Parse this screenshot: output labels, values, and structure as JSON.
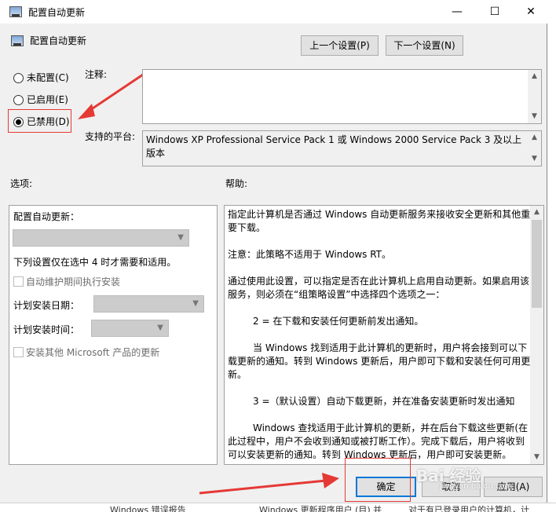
{
  "window": {
    "title": "配置自动更新",
    "minimize_glyph": "—",
    "maximize_glyph": "☐",
    "close_glyph": "✕"
  },
  "header": {
    "policy_name": "配置自动更新",
    "prev_setting": "上一个设置(P)",
    "next_setting": "下一个设置(N)"
  },
  "state": {
    "options": [
      {
        "label": "未配置(C)",
        "checked": false
      },
      {
        "label": "已启用(E)",
        "checked": false
      },
      {
        "label": "已禁用(D)",
        "checked": true
      }
    ]
  },
  "comment": {
    "label": "注释:",
    "value": ""
  },
  "platform": {
    "label": "支持的平台:",
    "value": "Windows XP Professional Service Pack 1 或 Windows 2000 Service Pack 3 及以上版本"
  },
  "options_section": {
    "label": "选项:",
    "configure_label": "配置自动更新：",
    "note": "下列设置仅在选中 4 时才需要和适用。",
    "maintenance_checkbox": "自动维护期间执行安装",
    "install_day_label": "计划安装日期：",
    "install_time_label": "计划安装时间：",
    "other_products_checkbox": "安装其他 Microsoft 产品的更新"
  },
  "help_section": {
    "label": "帮助:",
    "paragraphs": [
      "指定此计算机是否通过 Windows 自动更新服务来接收安全更新和其他重要下载。",
      "注意：此策略不适用于 Windows RT。",
      "通过使用此设置，可以指定是否在此计算机上启用自动更新。如果启用该服务，则必须在“组策略设置”中选择四个选项之一：",
      "2 = 在下载和安装任何更新前发出通知。",
      "当 Windows 找到适用于此计算机的更新时，用户将会接到可以下载更新的通知。转到 Windows 更新后，用户即可下载和安装任何可用更新。",
      "3 =（默认设置）自动下载更新，并在准备安装更新时发出通知",
      "Windows 查找适用于此计算机的更新，并在后台下载这些更新(在此过程中，用户不会收到通知或被打断工作）。完成下载后，用户将收到可以安装更新的通知。转到 Windows 更新后，用户即可安装更新。"
    ]
  },
  "footer": {
    "ok": "确定",
    "cancel": "取消",
    "apply": "应用(A)"
  },
  "background": {
    "bottom_left": "Windows 错误报告",
    "bottom_mid": "Windows 更新程序用户 (目) 并",
    "bottom_right": "对于有已登录用户的计算机，计"
  },
  "watermark": {
    "brand": "Bai 经验",
    "url": "jingyan.baidu.com"
  },
  "colors": {
    "accent": "#0078d7",
    "annotation_red": "#e53935",
    "dialog_bg": "#f0f0f0"
  }
}
